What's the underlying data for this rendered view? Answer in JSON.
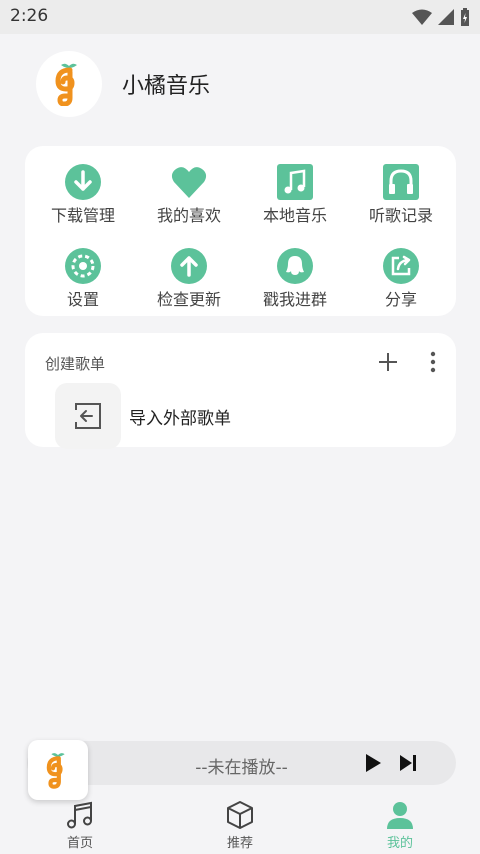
{
  "status_bar": {
    "time": "2:26"
  },
  "profile": {
    "app_name": "小橘音乐"
  },
  "grid": [
    {
      "label": "下载管理",
      "icon": "download-icon"
    },
    {
      "label": "我的喜欢",
      "icon": "heart-icon"
    },
    {
      "label": "本地音乐",
      "icon": "music-note-icon"
    },
    {
      "label": "听歌记录",
      "icon": "headphones-icon"
    },
    {
      "label": "设置",
      "icon": "gear-icon"
    },
    {
      "label": "检查更新",
      "icon": "upload-icon"
    },
    {
      "label": "戳我进群",
      "icon": "qq-icon"
    },
    {
      "label": "分享",
      "icon": "share-icon"
    }
  ],
  "playlists": {
    "title": "创建歌单",
    "import_label": "导入外部歌单"
  },
  "player": {
    "now_playing": "--未在播放--"
  },
  "tabs": [
    {
      "label": "首页",
      "icon": "music-note-icon"
    },
    {
      "label": "推荐",
      "icon": "cube-icon"
    },
    {
      "label": "我的",
      "icon": "person-icon",
      "active": true
    }
  ],
  "colors": {
    "accent": "#5cc29a",
    "background": "#f4f4f6",
    "logo_orange": "#f0921e"
  }
}
